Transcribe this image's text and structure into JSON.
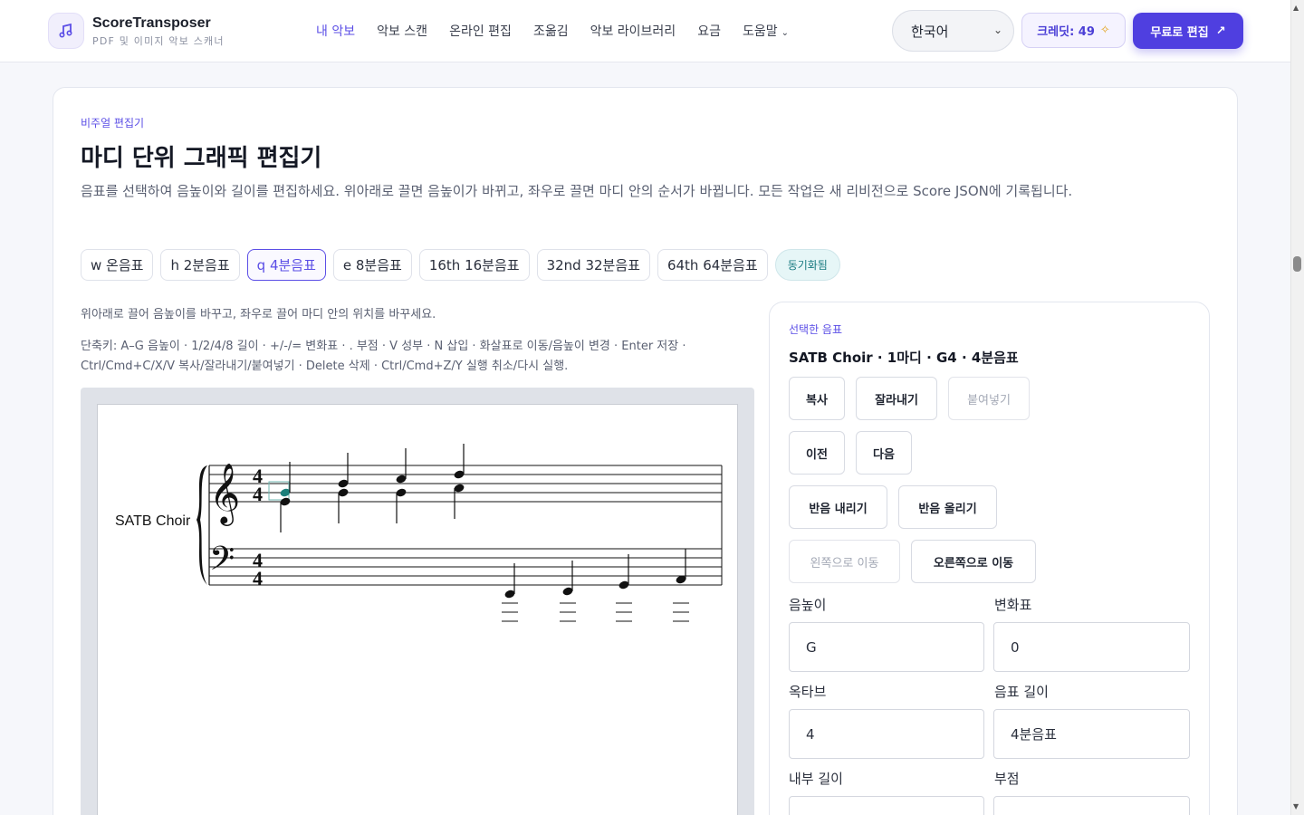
{
  "header": {
    "brand": "ScoreTransposer",
    "brand_sub": "PDF 및 이미지 악보 스캐너",
    "nav": [
      "내 악보",
      "악보 스캔",
      "온라인 편집",
      "조옮김",
      "악보 라이브러리",
      "요금",
      "도움말"
    ],
    "language": "한국어",
    "credits": "크레딧: 49",
    "cta": "무료로 편집"
  },
  "editor": {
    "eyebrow": "비주얼 편집기",
    "title": "마디 단위 그래픽 편집기",
    "description": "음표를 선택하여 음높이와 길이를 편집하세요. 위아래로 끌면 음높이가 바뀌고, 좌우로 끌면 마디 안의 순서가 바뀝니다. 모든 작업은 새 리비전으로 Score JSON에 기록됩니다.",
    "durations": [
      "w 온음표",
      "h 2분음표",
      "q 4분음표",
      "e 8분음표",
      "16th 16분음표",
      "32nd 32분음표",
      "64th 64분음표"
    ],
    "selected_duration": "q 4분음표",
    "sync_badge": "동기화됨",
    "hint_drag": "위아래로 끌어 음높이를 바꾸고, 좌우로 끌어 마디 안의 위치를 바꾸세요.",
    "hint_keys": "단축키: A–G 음높이 · 1/2/4/8 길이 · +/-/= 변화표 · . 부점 · V 성부 · N 삽입 · 화살표로 이동/음높이 변경 · Enter 저장 · Ctrl/Cmd+C/X/V 복사/잘라내기/붙여넣기 · Delete 삭제 · Ctrl/Cmd+Z/Y 실행 취소/다시 실행.",
    "score": {
      "part_name": "SATB Choir",
      "time_signature": "4/4",
      "treble_clef": "treble",
      "bass_clef": "bass",
      "selected_note": "G4"
    }
  },
  "panel": {
    "label": "선택한 음표",
    "title": "SATB Choir · 1마디 · G4 · 4분음표",
    "buttons": {
      "copy": "복사",
      "cut": "잘라내기",
      "paste": "붙여넣기",
      "prev": "이전",
      "next": "다음",
      "semitone_down": "반음 내리기",
      "semitone_up": "반음 올리기",
      "move_left": "왼쪽으로 이동",
      "move_right": "오른쪽으로 이동"
    },
    "fields": {
      "pitch_label": "음높이",
      "pitch_value": "G",
      "accidental_label": "변화표",
      "accidental_value": "0",
      "octave_label": "옥타브",
      "octave_value": "4",
      "duration_label": "음표 길이",
      "duration_value": "4분음표",
      "internal_label": "내부 길이",
      "internal_value": "",
      "dot_label": "부점",
      "dot_value": ""
    }
  },
  "colors": {
    "accent": "#5b4ee6",
    "selected_note": "#1a7f7a"
  }
}
